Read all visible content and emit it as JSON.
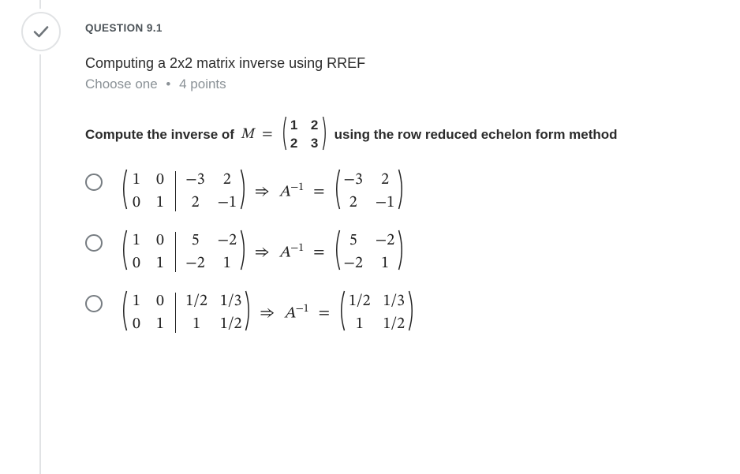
{
  "question": {
    "label": "QUESTION 9.1",
    "title": "Computing a 2x2 matrix inverse using RREF",
    "meta_type": "Choose one",
    "meta_points": "4 points",
    "prompt_lead": "Compute the inverse of",
    "prompt_var": "M",
    "prompt_eq": "=",
    "prompt_matrix": [
      [
        "1",
        "2"
      ],
      [
        "2",
        "3"
      ]
    ],
    "prompt_tail": "using the row reduced echelon form method"
  },
  "connective_arrow": "⇒",
  "connective_inv_sym": "A",
  "connective_inv_exp": "−1",
  "connective_eq": "=",
  "options": [
    {
      "aug_left": [
        [
          "1",
          "0"
        ],
        [
          "0",
          "1"
        ]
      ],
      "aug_right": [
        [
          "−3",
          "2"
        ],
        [
          "2",
          "−1"
        ]
      ],
      "result": [
        [
          "−3",
          "2"
        ],
        [
          "2",
          "−1"
        ]
      ]
    },
    {
      "aug_left": [
        [
          "1",
          "0"
        ],
        [
          "0",
          "1"
        ]
      ],
      "aug_right": [
        [
          "5",
          "−2"
        ],
        [
          "−2",
          "1"
        ]
      ],
      "result": [
        [
          "5",
          "−2"
        ],
        [
          "−2",
          "1"
        ]
      ]
    },
    {
      "aug_left": [
        [
          "1",
          "0"
        ],
        [
          "0",
          "1"
        ]
      ],
      "aug_right": [
        [
          "1/2",
          "1/3"
        ],
        [
          "1",
          "1/2"
        ]
      ],
      "result": [
        [
          "1/2",
          "1/3"
        ],
        [
          "1",
          "1/2"
        ]
      ]
    }
  ],
  "status": "correct"
}
